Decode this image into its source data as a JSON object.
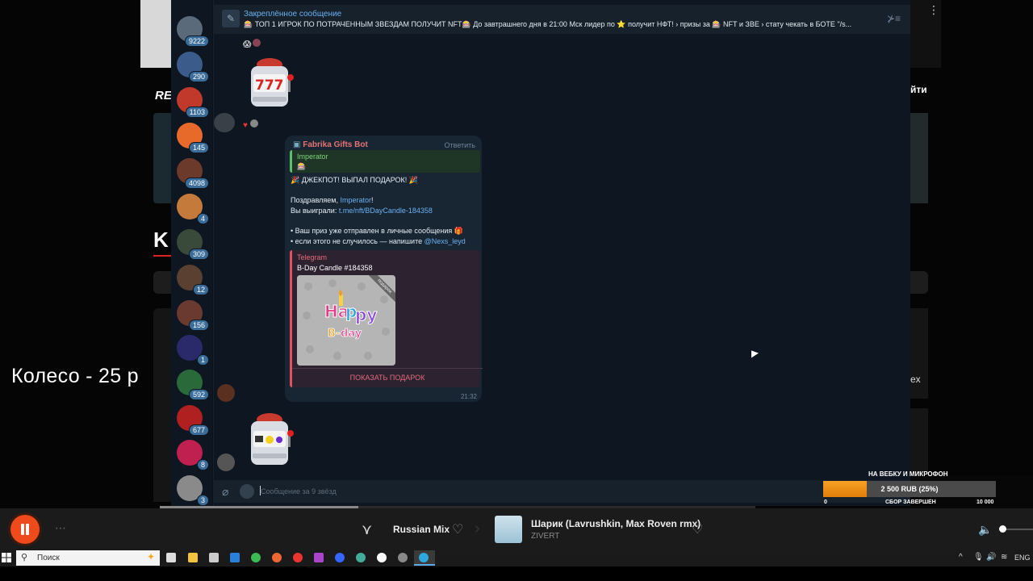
{
  "background": {
    "left_logo_fragment": "RE",
    "left_big_letter": "K",
    "overlay_text": "Колесо - 25 р",
    "right_text_fragment": "йти",
    "right_text_fragment2": "ex"
  },
  "telegram": {
    "channels": [
      {
        "badge": "9222",
        "color": "#5a6a7a"
      },
      {
        "badge": "290",
        "color": "#3b5b8a"
      },
      {
        "badge": "1103",
        "color": "#c0392b"
      },
      {
        "badge": "145",
        "color": "#e86a2a"
      },
      {
        "badge": "4098",
        "color": "#6b3a2a"
      },
      {
        "badge": "4",
        "color": "#c47a3a"
      },
      {
        "badge": "309",
        "color": "#3a4a3a"
      },
      {
        "badge": "12",
        "color": "#5a4030"
      },
      {
        "badge": "156",
        "color": "#6a3a30"
      },
      {
        "badge": "1",
        "color": "#2a2a6a"
      },
      {
        "badge": "592",
        "color": "#2a6a3a"
      },
      {
        "badge": "677",
        "color": "#b02020"
      },
      {
        "badge": "8",
        "color": "#c02050"
      },
      {
        "badge": "3",
        "color": "#8a8a8a"
      }
    ],
    "pinned": {
      "title": "Закреплённое сообщение",
      "text": "🎰 ТОП 1 ИГРОК ПО ПОТРАЧЕННЫМ ЗВЕЗДАМ ПОЛУЧИТ NFT🎰  До завтрашнего дня в 21:00 Мск лидер по ⭐ получит НФТ!  › призы за 🎰 NFT и ЗВЕ  › стату чекать в БОТЕ \"/s..."
    },
    "message": {
      "sender": "Fabrika Gifts Bot",
      "reply_label": "Ответить",
      "quote_name": "Imperator",
      "quote_icon": "🎰",
      "jackpot": "🎉 ДЖЕКПОТ! ВЫПАЛ ПОДАРОК! 🎉",
      "congrats_prefix": "Поздравляем, ",
      "congrats_name": "Imperator",
      "congrats_suffix": "!",
      "won_prefix": "Вы выиграли: ",
      "won_link": "t.me/nft/BDayCandle-184358",
      "bullet1": "• Ваш приз уже отправлен в личные сообщения 🎁",
      "bullet2_prefix": "• если этого не случилось — напишите ",
      "bullet2_handle": "@Nexs_leyd",
      "preview_site": "Telegram",
      "preview_title": "B-Day Candle #184358",
      "preview_ribbon": "подарок",
      "preview_image_text": "Happy B-day",
      "preview_button": "ПОКАЗАТЬ ПОДАРОК",
      "time": "21:32"
    },
    "compose_placeholder": "Сообщение за 9 звёзд"
  },
  "donation": {
    "title": "НА ВЕБКУ И МИКРОФОН",
    "value_label": "2 500 RUB (25%)",
    "progress": 0.25,
    "min": "0",
    "status": "СБОР ЗАВЕРШЕН",
    "max": "10 000"
  },
  "player": {
    "playlist": "Russian Mix",
    "track": "Шарик (Lavrushkin, Max Roven rmx)",
    "artist": "ZIVERT"
  },
  "taskbar": {
    "search_placeholder": "Поиск",
    "language": "ENG"
  }
}
